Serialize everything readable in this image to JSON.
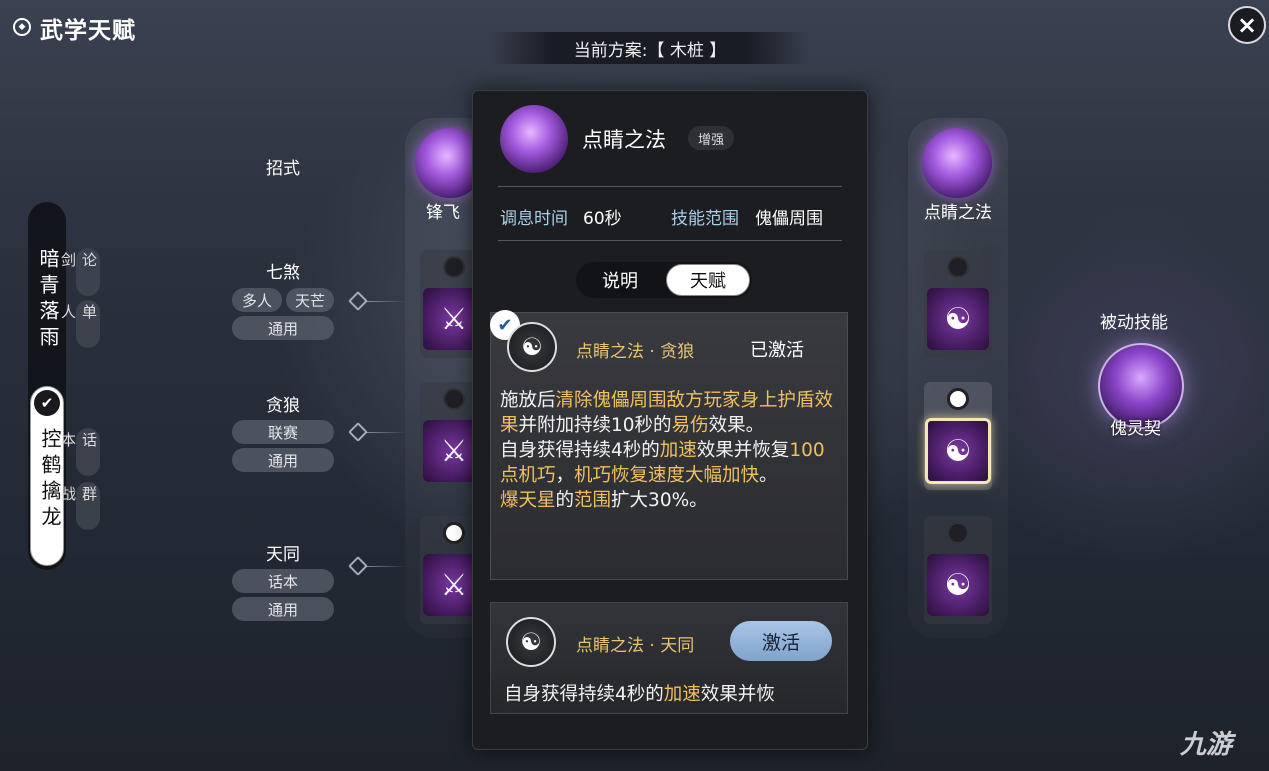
{
  "header": {
    "title_icon": "settings-dots-icon",
    "title": "武学天赋",
    "close_icon": "×",
    "plan_label": "当前方案:【 木桩 】"
  },
  "schools": {
    "items": [
      {
        "name": "暗青落雨",
        "modes": [
          "论剑",
          "单人"
        ],
        "selected": false
      },
      {
        "name": "控鹤擒龙",
        "modes": [
          "话本",
          "群战"
        ],
        "selected": true
      }
    ],
    "check_icon": "✔"
  },
  "rows": [
    {
      "title": "招式",
      "tags": []
    },
    {
      "title": "七煞",
      "tags": [
        "多人",
        "天芒",
        "通用"
      ]
    },
    {
      "title": "贪狼",
      "tags": [
        "联赛",
        "通用"
      ]
    },
    {
      "title": "天同",
      "tags": [
        "话本",
        "通用"
      ]
    }
  ],
  "columns": [
    {
      "skill_name": "锋飞",
      "slots": [
        {
          "icon": "⚔",
          "on": false
        },
        {
          "icon": "⚔",
          "on": false
        },
        {
          "icon": "⚔",
          "on": true
        }
      ]
    },
    {
      "skill_name": "点睛之法",
      "slots": [
        {
          "icon": "☯",
          "on": false
        },
        {
          "icon": "☯",
          "on": true
        },
        {
          "icon": "☯",
          "on": false
        }
      ]
    }
  ],
  "passive": {
    "title": "被动技能",
    "name": "傀灵契"
  },
  "popup": {
    "skill_name": "点睛之法",
    "badge": "增强",
    "stat1_label": "调息时间",
    "stat1_value": "60秒",
    "stat2_label": "技能范围",
    "stat2_value": "傀儡周围",
    "tab_desc": "说明",
    "tab_talent": "天赋",
    "talent1": {
      "name": "点睛之法 · 贪狼",
      "status": "已激活",
      "text_parts": [
        [
          "施放后",
          "清除傀儡周围敌方玩家身上护盾效果",
          "并附加持续10秒的",
          "易伤",
          "效果。"
        ],
        [
          "自身获得持续4秒的",
          "加速",
          "效果并恢复",
          "100点机巧",
          "，",
          "机巧恢复速度大幅加快",
          "。"
        ],
        [
          "爆天星",
          "的",
          "范围",
          "扩大30%。"
        ]
      ]
    },
    "talent2": {
      "name": "点睛之法 · 天同",
      "button": "激活",
      "text_a": "自身获得持续4秒的",
      "text_hl": "加速",
      "text_b": "效果并恢"
    }
  },
  "watermark": "九游"
}
